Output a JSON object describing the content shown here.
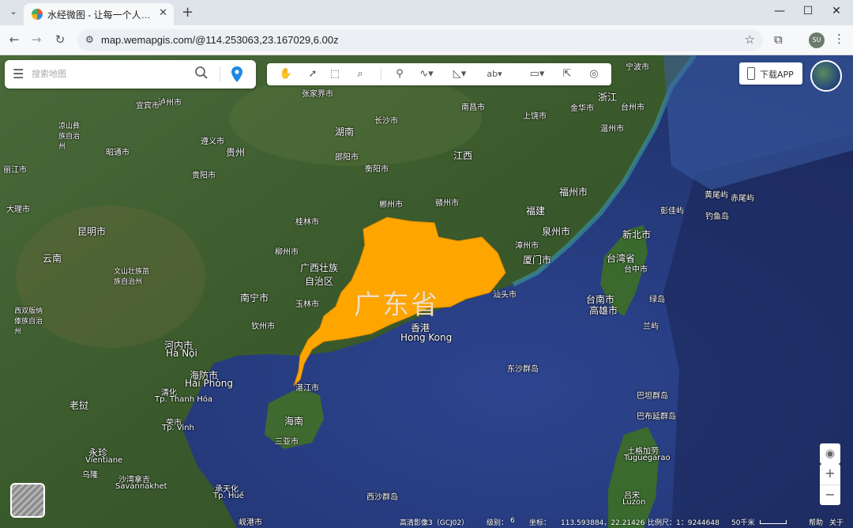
{
  "browser": {
    "tab_title": "水经微图 - 让每一个人都有自己",
    "url": "map.wemapgis.com/@114.253063,23.167029,6.00z",
    "avatar_text": "SU"
  },
  "search": {
    "placeholder": "搜索地图"
  },
  "download_label": "下载APP",
  "map_labels": {
    "province_highlight": "广东省",
    "hongkong_cn": "香港",
    "hongkong_en": "Hong Kong",
    "places": [
      {
        "id": "ningbo",
        "text": "宁波市"
      },
      {
        "id": "zhangjiajie",
        "text": "张家界市"
      },
      {
        "id": "yibin",
        "text": "宜宾市"
      },
      {
        "id": "luzhou",
        "text": "泸州市"
      },
      {
        "id": "hunan",
        "text": "湖南"
      },
      {
        "id": "nanchang",
        "text": "南昌市"
      },
      {
        "id": "jinhua",
        "text": "金华市"
      },
      {
        "id": "zhejiang",
        "text": "浙江"
      },
      {
        "id": "taizhou",
        "text": "台州市"
      },
      {
        "id": "changsha",
        "text": "长沙市"
      },
      {
        "id": "shangrao",
        "text": "上饶市"
      },
      {
        "id": "wenzhou",
        "text": "温州市"
      },
      {
        "id": "liangshan",
        "text": "凉山彝族自治州"
      },
      {
        "id": "zunyi",
        "text": "遵义市"
      },
      {
        "id": "guizhou",
        "text": "贵州"
      },
      {
        "id": "shaoyang",
        "text": "邵阳市"
      },
      {
        "id": "jiangxi",
        "text": "江西"
      },
      {
        "id": "zhaotong",
        "text": "昭通市"
      },
      {
        "id": "hengyang",
        "text": "衡阳市"
      },
      {
        "id": "guiyang",
        "text": "贵阳市"
      },
      {
        "id": "lijiang",
        "text": "丽江市"
      },
      {
        "id": "fuzhou",
        "text": "福州市"
      },
      {
        "id": "diaoyu_north",
        "text": "黄尾屿"
      },
      {
        "id": "chiwei",
        "text": "赤尾屿"
      },
      {
        "id": "dali",
        "text": "大理市"
      },
      {
        "id": "chenzhou",
        "text": "郴州市"
      },
      {
        "id": "ganzhou",
        "text": "赣州市"
      },
      {
        "id": "fujian",
        "text": "福建"
      },
      {
        "id": "pengjia",
        "text": "彭佳屿"
      },
      {
        "id": "diaoyu",
        "text": "钓鱼岛"
      },
      {
        "id": "guilin",
        "text": "桂林市"
      },
      {
        "id": "kunming",
        "text": "昆明市"
      },
      {
        "id": "quanzhou",
        "text": "泉州市"
      },
      {
        "id": "xinbei",
        "text": "新北市"
      },
      {
        "id": "zhangzhou",
        "text": "漳州市"
      },
      {
        "id": "yunnan",
        "text": "云南"
      },
      {
        "id": "liuzhou",
        "text": "柳州市"
      },
      {
        "id": "xiamen",
        "text": "厦门市"
      },
      {
        "id": "taiwan",
        "text": "台湾省"
      },
      {
        "id": "guangxi",
        "text": "广西壮族自治区"
      },
      {
        "id": "wenshan",
        "text": "文山壮族苗族自治州"
      },
      {
        "id": "taizhong",
        "text": "台中市"
      },
      {
        "id": "nanning",
        "text": "南宁市"
      },
      {
        "id": "yulin",
        "text": "玉林市"
      },
      {
        "id": "shantou",
        "text": "汕头市"
      },
      {
        "id": "tainan",
        "text": "台南市"
      },
      {
        "id": "lvdao",
        "text": "绿岛"
      },
      {
        "id": "xishuangbanna",
        "text": "西双版纳傣族自治州"
      },
      {
        "id": "qinzhou",
        "text": "钦州市"
      },
      {
        "id": "gaoxiong",
        "text": "高雄市"
      },
      {
        "id": "lanyu",
        "text": "兰屿"
      },
      {
        "id": "hanoi_cn",
        "text": "河内市"
      },
      {
        "id": "hanoi",
        "text": "Hà Nội"
      },
      {
        "id": "dongsha",
        "text": "东沙群岛"
      },
      {
        "id": "haiphong_cn",
        "text": "海防市"
      },
      {
        "id": "haiphong",
        "text": "Hải Phòng"
      },
      {
        "id": "zhanjiang",
        "text": "湛江市"
      },
      {
        "id": "thanhhoa_cn",
        "text": "清化"
      },
      {
        "id": "thanhhoa",
        "text": "Tp. Thanh Hóa"
      },
      {
        "id": "laos",
        "text": "老挝"
      },
      {
        "id": "batanes",
        "text": "巴坦群岛"
      },
      {
        "id": "hainan",
        "text": "海南"
      },
      {
        "id": "babuyan",
        "text": "巴布延群岛"
      },
      {
        "id": "vinh_cn",
        "text": "荣市"
      },
      {
        "id": "vinh",
        "text": "Tp. Vinh"
      },
      {
        "id": "sanya",
        "text": "三亚市"
      },
      {
        "id": "tuguegarao_cn",
        "text": "土格加劳"
      },
      {
        "id": "tuguegarao",
        "text": "Tuguegarao"
      },
      {
        "id": "luangprabang",
        "text": "永珍"
      },
      {
        "id": "vientiane",
        "text": "Vientiane"
      },
      {
        "id": "udon",
        "text": "乌隆"
      },
      {
        "id": "savannakhet",
        "text": "沙湾拿吉"
      },
      {
        "id": "savannakhet_en",
        "text": "Savannakhet"
      },
      {
        "id": "hue_cn",
        "text": "承天化"
      },
      {
        "id": "hue",
        "text": "Tp. Huế"
      },
      {
        "id": "xisha",
        "text": "西沙群岛"
      },
      {
        "id": "luzon_cn",
        "text": "吕宋"
      },
      {
        "id": "luzon",
        "text": "Luzon"
      },
      {
        "id": "danang",
        "text": "岘港市"
      }
    ]
  },
  "status_bar": {
    "source": "高清影像3（GCJ02）",
    "level_label": "级别：",
    "level_value": "6",
    "coord_label": "坐标：",
    "coord_value": "113.593884，22.21426",
    "scale_label": "比例尺：1：9244648",
    "scale_text": "50千米",
    "help": "帮助",
    "about": "关于"
  },
  "colors": {
    "highlight_province": "#FFA500",
    "sea": "#2b3d7c",
    "land": "#3d5a2e"
  },
  "icons": {
    "toolbar": [
      "hand-pan-icon",
      "select-arrow-icon",
      "box-select-icon",
      "zoom-search-icon",
      "location-pin-icon",
      "polyline-icon",
      "area-measure-icon",
      "text-label-icon",
      "ruler-icon",
      "cursor-tool-icon",
      "globe-tool-icon"
    ]
  }
}
